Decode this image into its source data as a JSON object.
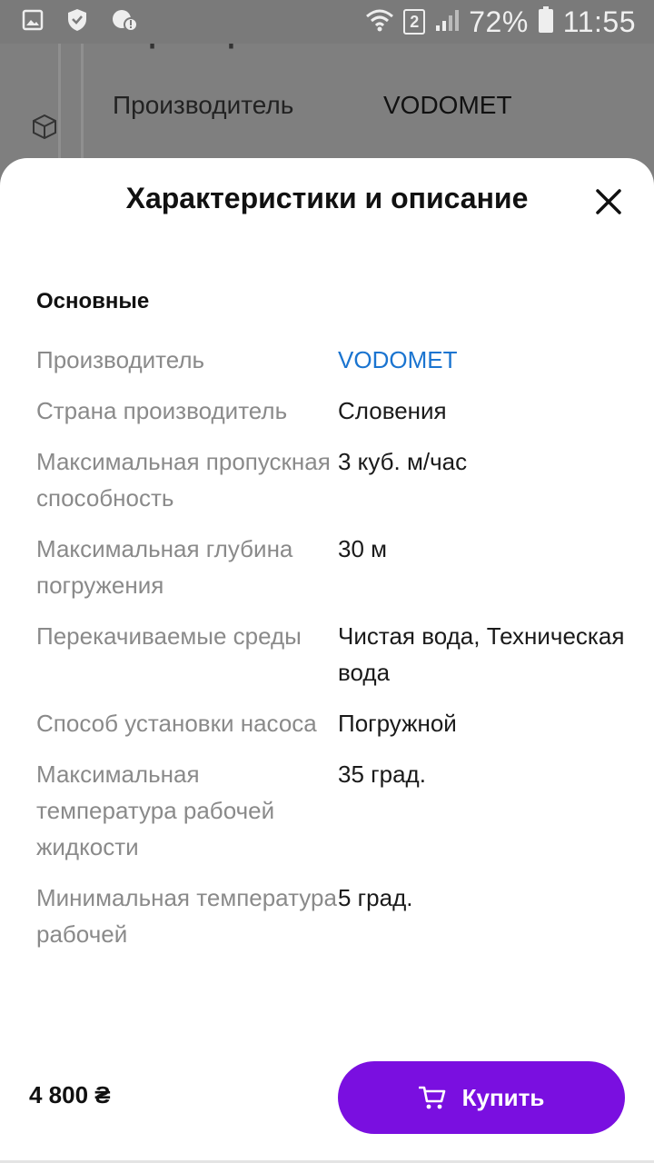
{
  "status_bar": {
    "battery_percent": "72%",
    "time": "11:55",
    "sim_slot": "2",
    "icons": [
      "gallery-icon",
      "shield-icon",
      "vpn-alert-icon",
      "wifi-icon",
      "sim-icon",
      "signal-icon",
      "battery-icon"
    ]
  },
  "background": {
    "heading": "Характеристики",
    "row_label": "Производитель",
    "row_value": "VODOMET"
  },
  "sheet": {
    "title": "Характеристики и описание",
    "section_title": "Основные",
    "specs": [
      {
        "label": "Производитель",
        "value": "VODOMET",
        "is_link": true
      },
      {
        "label": "Страна производитель",
        "value": "Словения"
      },
      {
        "label": "Максимальная пропускная способность",
        "value": "3 куб. м/час"
      },
      {
        "label": "Максимальная глубина погружения",
        "value": "30 м"
      },
      {
        "label": "Перекачиваемые среды",
        "value": "Чистая вода, Техническая вода"
      },
      {
        "label": "Способ установки насоса",
        "value": "Погружной"
      },
      {
        "label": "Максимальная температура рабочей жидкости",
        "value": "35 град."
      },
      {
        "label": "Минимальная температура рабочей",
        "value": "5 град."
      }
    ]
  },
  "buy_bar": {
    "price": "4 800 ₴",
    "buy_label": "Купить"
  },
  "colors": {
    "accent": "#7a0fe0",
    "link": "#1a74d0",
    "overlay": "#7f7f7f"
  }
}
